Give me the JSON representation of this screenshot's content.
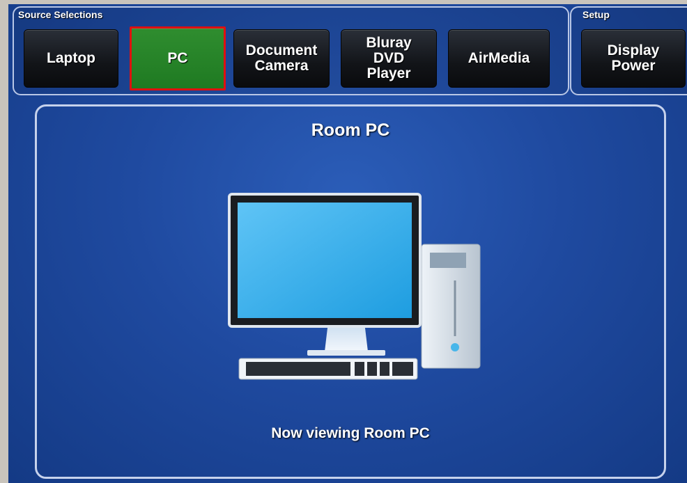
{
  "source_selections": {
    "title": "Source Selections",
    "buttons": [
      {
        "label": "Laptop"
      },
      {
        "label": "PC"
      },
      {
        "label": "Document\nCamera"
      },
      {
        "label": "Bluray\nDVD\nPlayer"
      },
      {
        "label": "AirMedia"
      }
    ],
    "selected": "PC"
  },
  "setup": {
    "title": "Setup",
    "buttons": [
      {
        "label": "Display\nPower"
      }
    ]
  },
  "main": {
    "title": "Room PC",
    "status": "Now viewing Room PC",
    "icon": "desktop-computer-icon"
  },
  "colors": {
    "background_blue": "#1f4aa0",
    "active_button": "#2f8d2f",
    "highlight_border": "#e01010"
  }
}
